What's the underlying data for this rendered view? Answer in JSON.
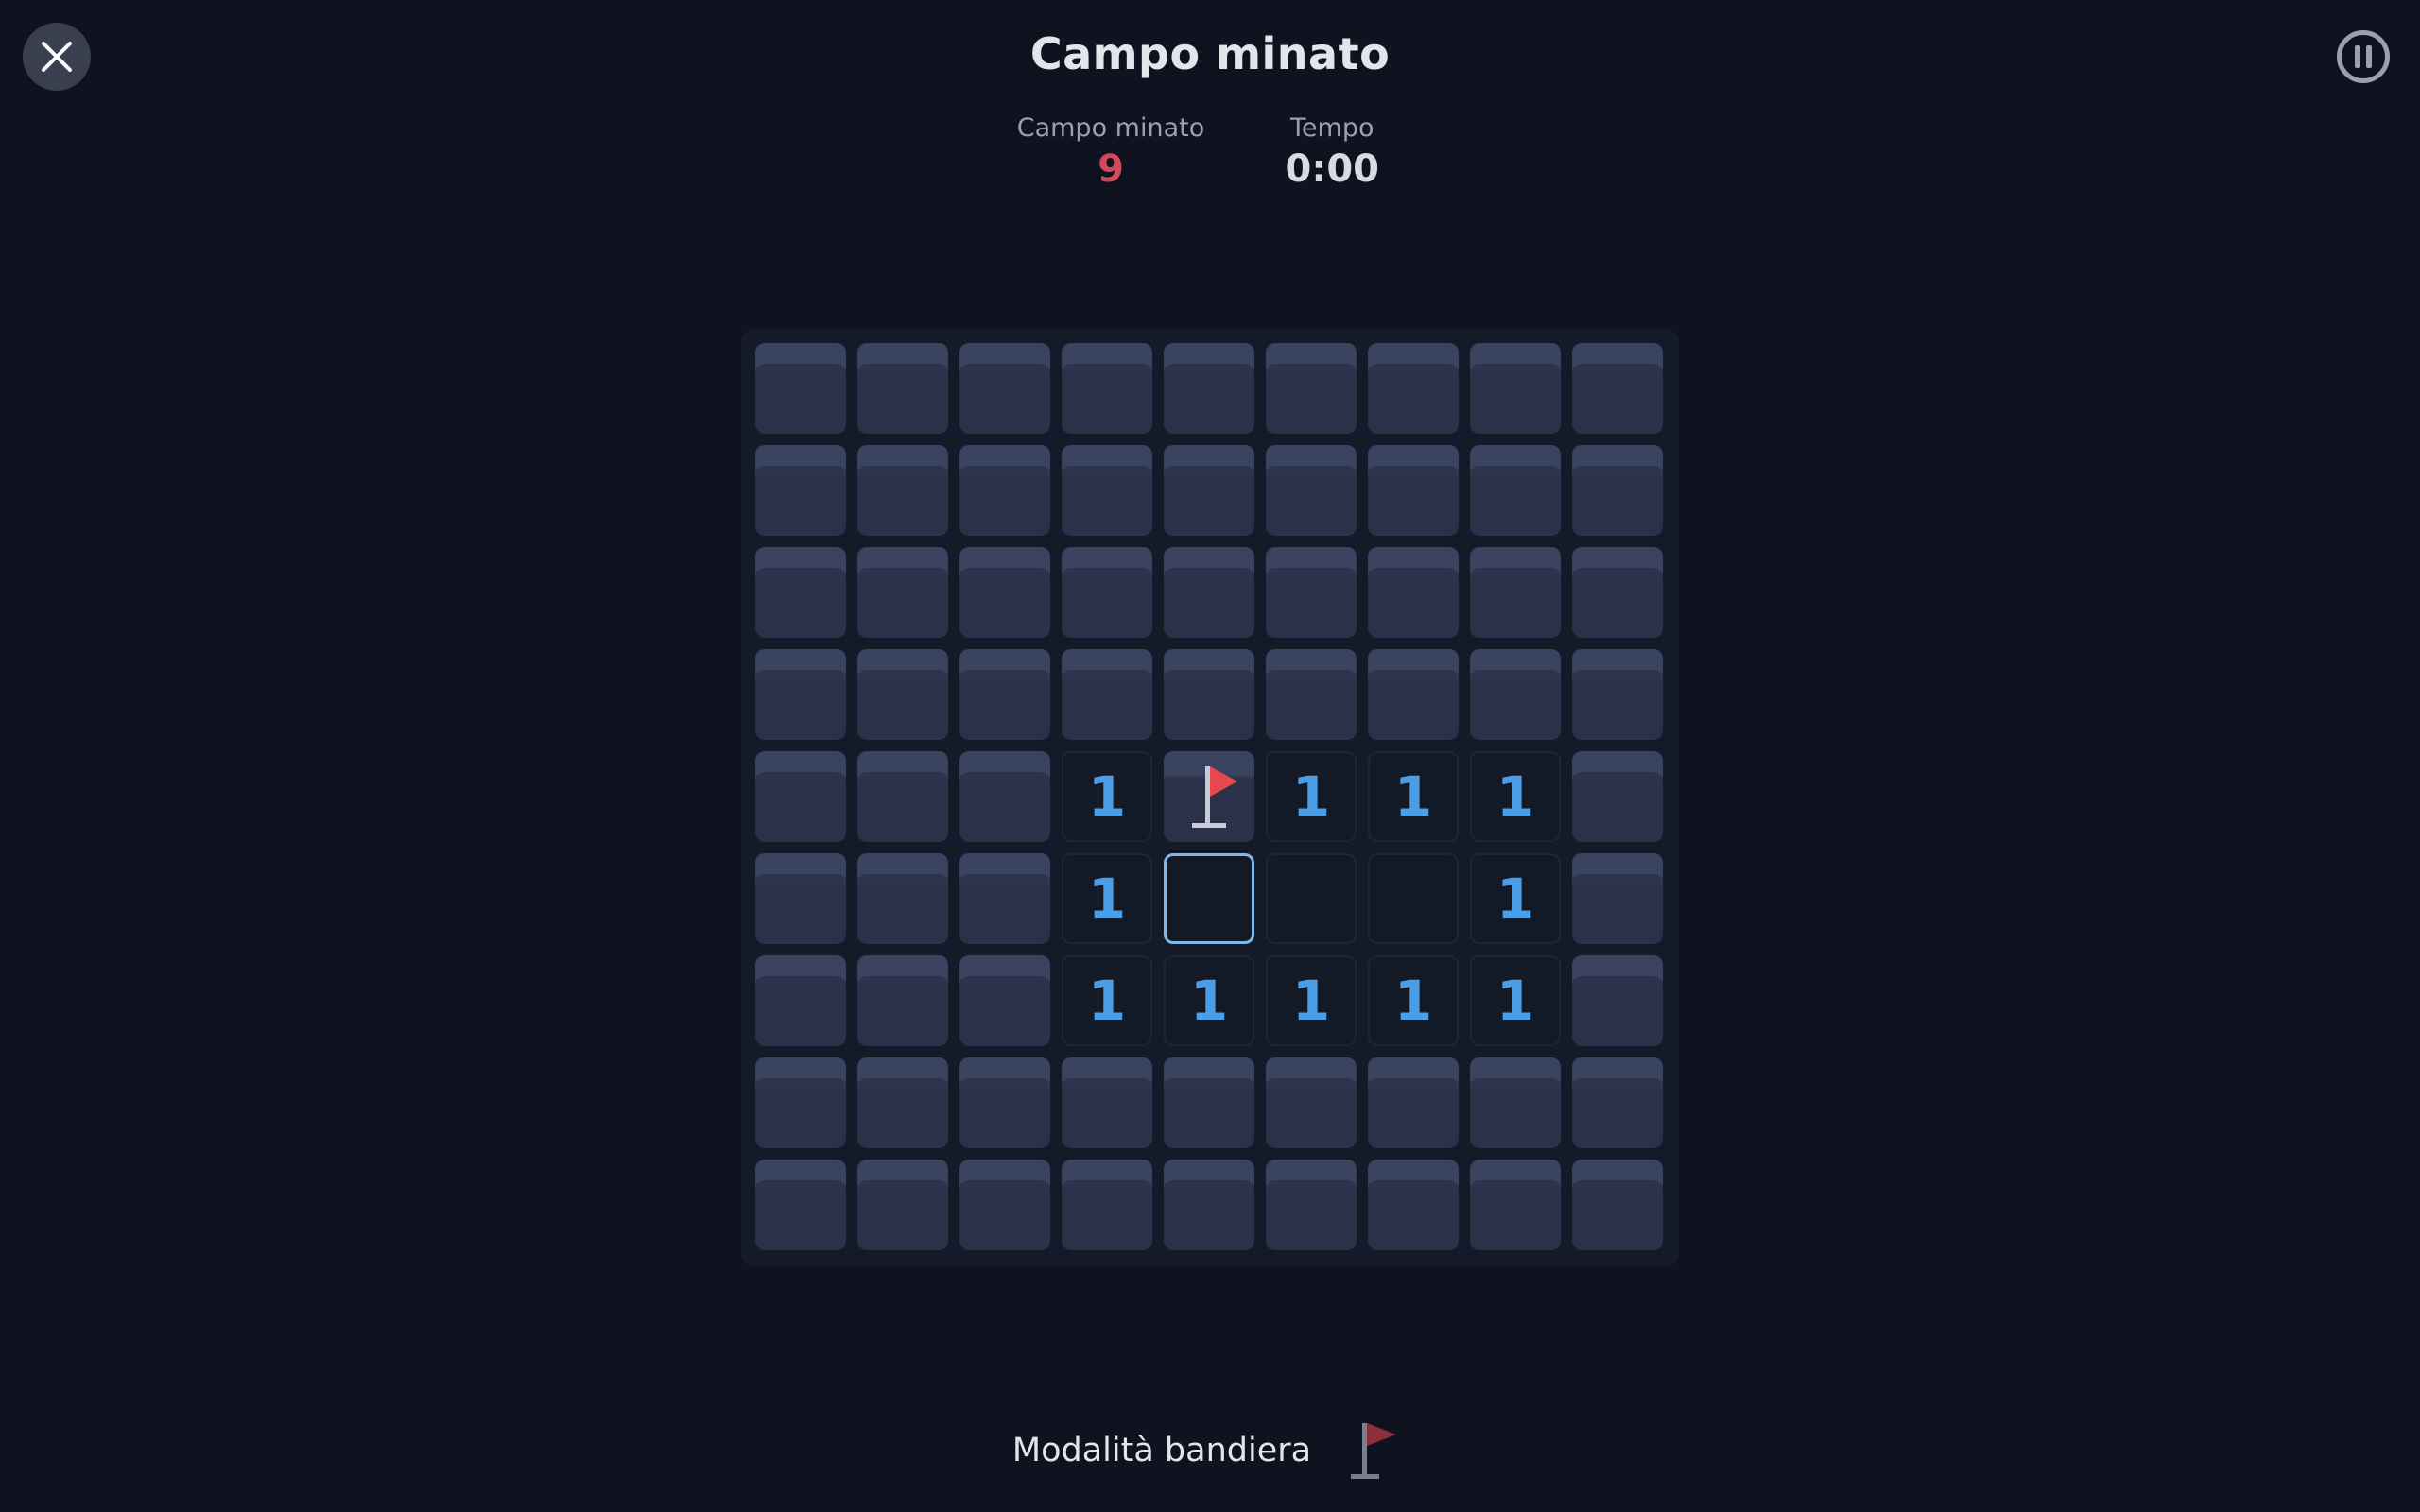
{
  "header": {
    "title": "Campo minato",
    "close_icon": "close-icon",
    "pause_icon": "pause-icon"
  },
  "stats": {
    "mines_label": "Campo minato",
    "mines_value": "9",
    "time_label": "Tempo",
    "time_value": "0:00"
  },
  "board": {
    "rows": 9,
    "cols": 9,
    "selected": [
      5,
      4
    ],
    "grid": [
      [
        "H",
        "H",
        "H",
        "H",
        "H",
        "H",
        "H",
        "H",
        "H"
      ],
      [
        "H",
        "H",
        "H",
        "H",
        "H",
        "H",
        "H",
        "H",
        "H"
      ],
      [
        "H",
        "H",
        "H",
        "H",
        "H",
        "H",
        "H",
        "H",
        "H"
      ],
      [
        "H",
        "H",
        "H",
        "H",
        "H",
        "H",
        "H",
        "H",
        "H"
      ],
      [
        "H",
        "H",
        "H",
        "1",
        "F",
        "1",
        "1",
        "1",
        "H"
      ],
      [
        "H",
        "H",
        "H",
        "1",
        "0",
        "0",
        "0",
        "1",
        "H"
      ],
      [
        "H",
        "H",
        "H",
        "1",
        "1",
        "1",
        "1",
        "1",
        "H"
      ],
      [
        "H",
        "H",
        "H",
        "H",
        "H",
        "H",
        "H",
        "H",
        "H"
      ],
      [
        "H",
        "H",
        "H",
        "H",
        "H",
        "H",
        "H",
        "H",
        "H"
      ]
    ]
  },
  "footer": {
    "flag_mode_label": "Modalità bandiera",
    "flag_mode_icon": "flag-icon"
  },
  "colors": {
    "background": "#0f1320",
    "number": "#4a9ee8",
    "mines_counter": "#d1495b",
    "flag": "#e5484d",
    "flag_mode_inactive": "#8b2f3c",
    "selection": "#7fb8e6"
  }
}
